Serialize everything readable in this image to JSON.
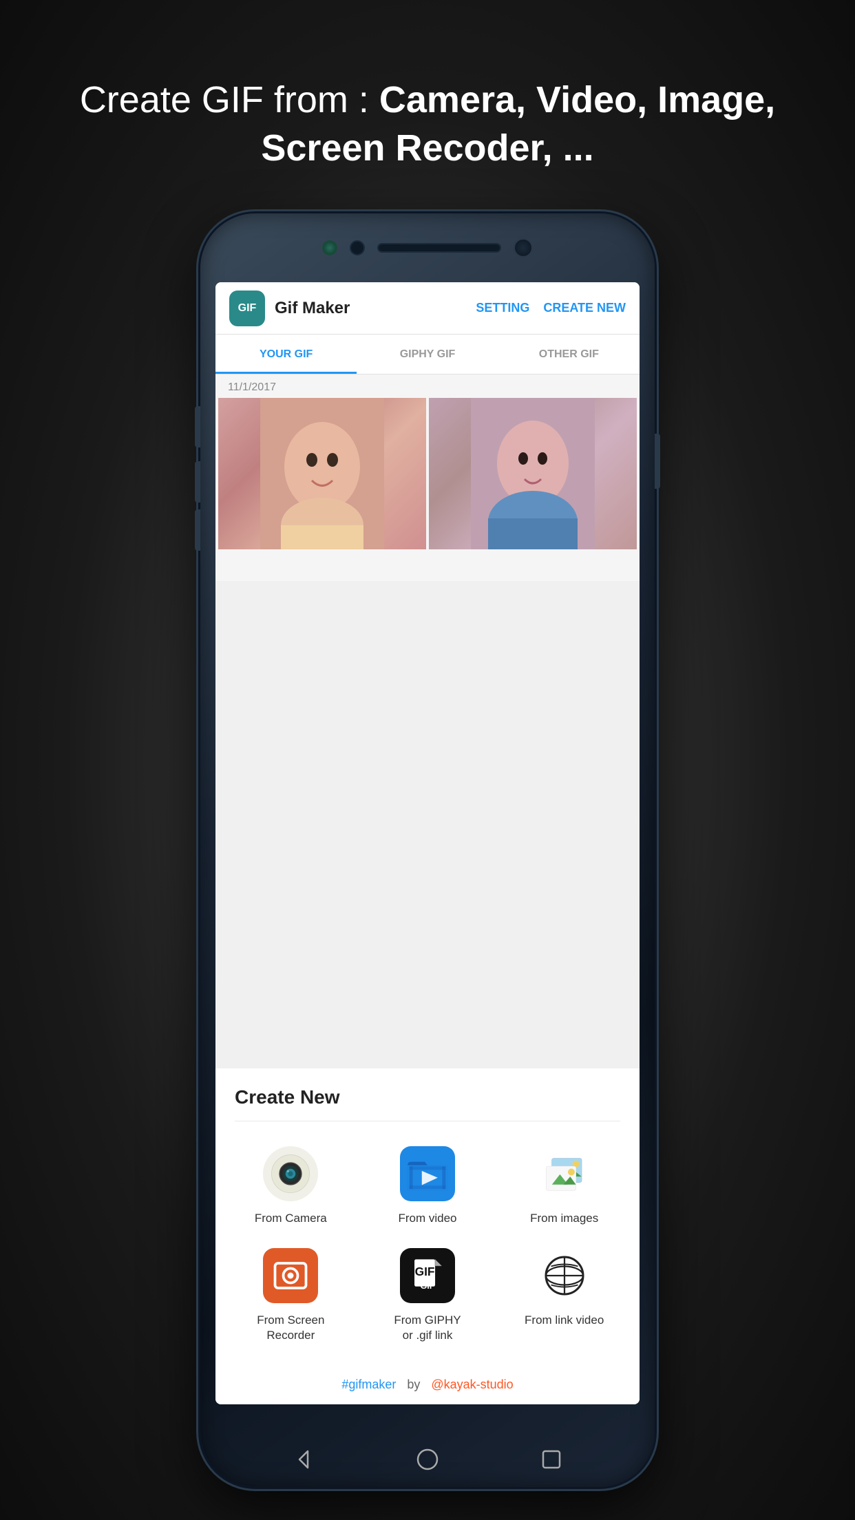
{
  "headline": {
    "text_normal": "Create GIF from : ",
    "text_bold": "Camera, Video, Image, Screen Recoder, ..."
  },
  "app": {
    "icon_text": "GIF",
    "title": "Gif Maker",
    "action_setting": "SETTING",
    "action_create": "CREATE NEW"
  },
  "tabs": [
    {
      "label": "YOUR GIF",
      "active": true
    },
    {
      "label": "GIPHY GIF",
      "active": false
    },
    {
      "label": "OTHER GIF",
      "active": false
    }
  ],
  "content": {
    "date": "11/1/2017"
  },
  "create_new": {
    "title": "Create New",
    "options": [
      {
        "id": "camera",
        "label": "From Camera"
      },
      {
        "id": "video",
        "label": "From video"
      },
      {
        "id": "images",
        "label": "From images"
      },
      {
        "id": "screen_recorder",
        "label": "From Screen\nRecorder"
      },
      {
        "id": "giphy",
        "label": "From GIPHY\nor .gif link"
      },
      {
        "id": "link_video",
        "label": "From link video"
      }
    ]
  },
  "footer": {
    "hashtag": "#gifmaker",
    "by": "by",
    "studio": "@kayak-studio"
  },
  "nav": {
    "back": "◁",
    "home": "○",
    "recent": "□"
  }
}
